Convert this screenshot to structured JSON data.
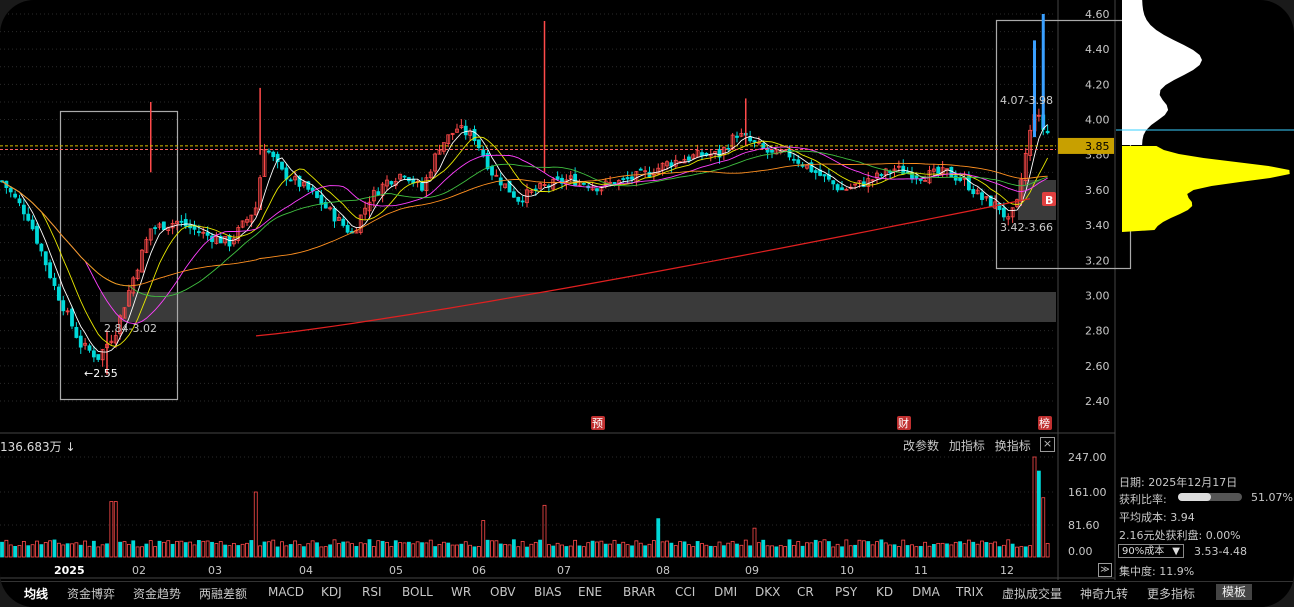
{
  "price_axis": [
    "4.60",
    "4.40",
    "4.20",
    "4.00",
    "3.80",
    "3.60",
    "3.40",
    "3.20",
    "3.00",
    "2.80",
    "2.60",
    "2.40"
  ],
  "current_price": "3.85",
  "volume_axis": [
    "247.00",
    "161.00",
    "81.60",
    "0.00"
  ],
  "month_labels": [
    "2025",
    "02",
    "03",
    "04",
    "05",
    "06",
    "07",
    "08",
    "09",
    "10",
    "11",
    "12"
  ],
  "annotations": {
    "low_price": "←2.55",
    "range_left": "2.84-3.02",
    "range_upper_right": "4.07-3.98",
    "range_lower_right": "3.42-3.66",
    "badge_b": "B",
    "event_yu": "预",
    "event_cai": "财",
    "event_bang": "榜"
  },
  "volume_panel": {
    "label": "136.683万",
    "label_arrow": "↓",
    "tools": [
      "改参数",
      "加指标",
      "换指标"
    ],
    "close": "×"
  },
  "chip_panel": {
    "date_label": "日期: 2025年12月17日",
    "profit_ratio_label": "获利比率:",
    "profit_ratio_value": "51.07%",
    "profit_ratio_fraction": 0.5107,
    "avg_cost_label": "平均成本: 3.94",
    "profit_at_label": "2.16元处获利盘: 0.00%",
    "cost_select": "90%成本",
    "cost_range": "3.53-4.48",
    "concentration": "集中度: 11.9%"
  },
  "bottom_tabs": [
    "均线",
    "资金博弈",
    "资金趋势",
    "两融差额",
    "MACD",
    "KDJ",
    "RSI",
    "BOLL",
    "WR",
    "OBV",
    "BIAS",
    "ENE",
    "BRAR",
    "CCI",
    "DMI",
    "DKX",
    "CR",
    "PSY",
    "KD",
    "DMA",
    "TRIX",
    "虚拟成交量",
    "神奇九转",
    "更多指标"
  ],
  "template_button": "模板",
  "scroll_arrow": "≫",
  "colors": {
    "up": "#ff4a4a",
    "down": "#00d8d8",
    "ma_white": "#ffffff",
    "ma_yellow": "#e8e800",
    "ma_magenta": "#ff40ff",
    "ma_green": "#40c040",
    "ma_orange": "#ff9020",
    "ma_red": "#e02020",
    "chip": "#ffff00"
  }
}
